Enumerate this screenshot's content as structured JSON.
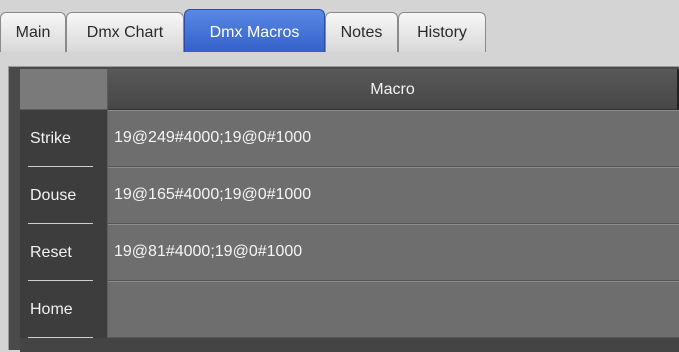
{
  "tabs": [
    {
      "label": "Main",
      "active": false
    },
    {
      "label": "Dmx Chart",
      "active": false
    },
    {
      "label": "Dmx Macros",
      "active": true
    },
    {
      "label": "Notes",
      "active": false
    },
    {
      "label": "History",
      "active": false
    }
  ],
  "grid": {
    "column_header": "Macro",
    "rows": [
      {
        "label": "Strike",
        "value": "19@249#4000;19@0#1000"
      },
      {
        "label": "Douse",
        "value": "19@165#4000;19@0#1000"
      },
      {
        "label": "Reset",
        "value": "19@81#4000;19@0#1000"
      },
      {
        "label": "Home",
        "value": ""
      }
    ]
  },
  "colors": {
    "active_tab": "#3561c9",
    "cell_background": "#6e6e6e",
    "row_header_background": "#3d3d3d"
  }
}
